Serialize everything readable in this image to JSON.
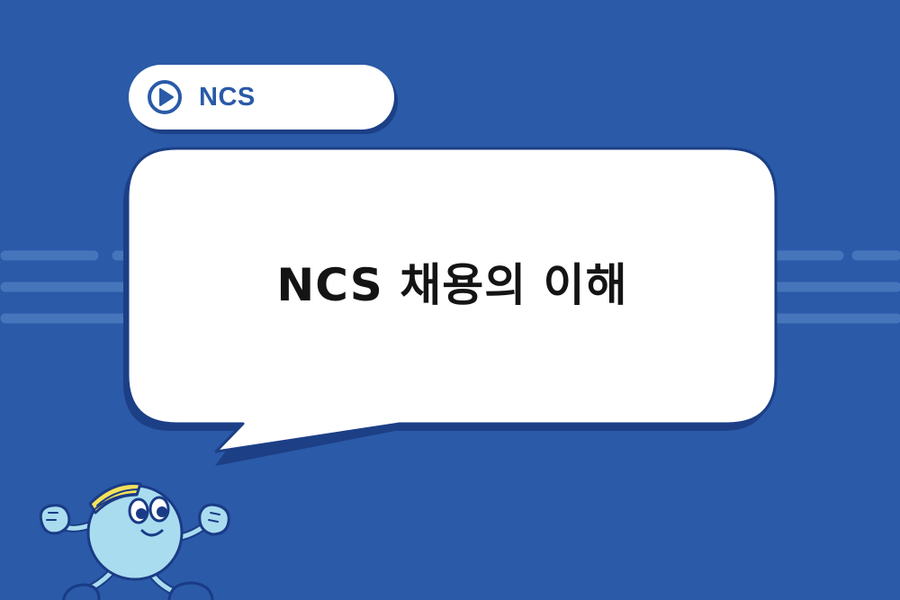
{
  "tag": {
    "icon": "play-circle-icon",
    "label": "NCS"
  },
  "bubble": {
    "title": "NCS 채용의 이해"
  },
  "mascot": {
    "icon": "running-mascot-icon"
  },
  "colors": {
    "background": "#2a5aa8",
    "accent": "#2a5aa8",
    "bubble_fill": "#ffffff",
    "bubble_shadow": "#1c3f86",
    "title_text": "#141414",
    "mascot_body": "#a9dcef",
    "mascot_outline": "#1a3b86",
    "headband": "#f5e25a"
  }
}
